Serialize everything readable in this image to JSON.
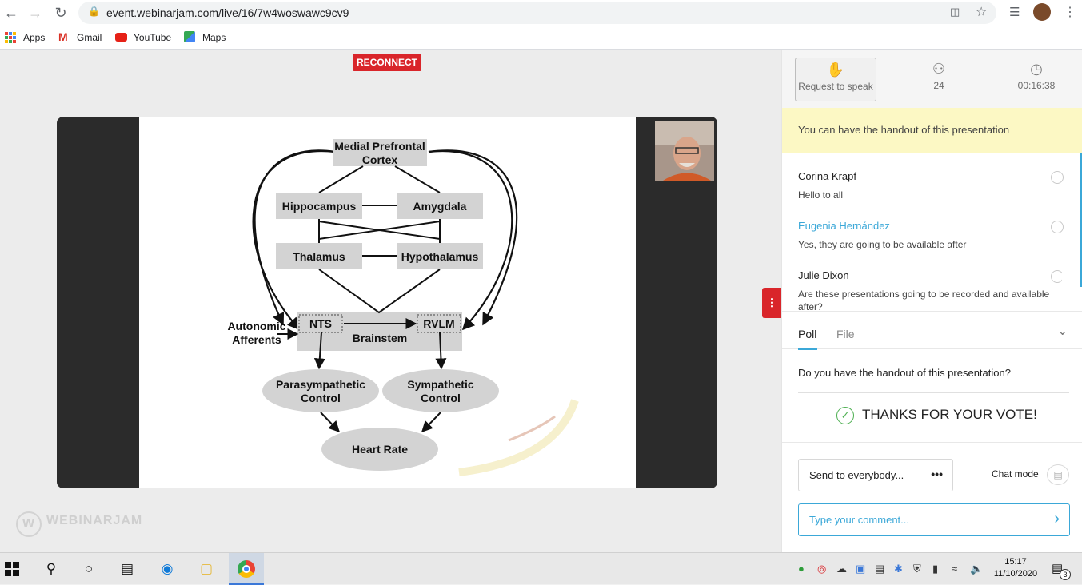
{
  "browser": {
    "url": "event.webinarjam.com/live/16/7w4woswawc9cv9",
    "bookmarks": [
      "Apps",
      "Gmail",
      "YouTube",
      "Maps"
    ]
  },
  "stage": {
    "reconnect_label": "RECONNECT",
    "watermark": "WEBINARJAM"
  },
  "slide": {
    "nodes": {
      "mpfc": [
        "Medial Prefrontal",
        "Cortex"
      ],
      "hippocampus": "Hippocampus",
      "amygdala": "Amygdala",
      "thalamus": "Thalamus",
      "hypothalamus": "Hypothalamus",
      "nts": "NTS",
      "rvlm": "RVLM",
      "brainstem": "Brainstem",
      "afferents": [
        "Autonomic",
        "Afferents"
      ],
      "parasympathetic": [
        "Parasympathetic",
        "Control"
      ],
      "sympathetic": [
        "Sympathetic",
        "Control"
      ],
      "heart_rate": "Heart Rate"
    }
  },
  "panel": {
    "request_label": "Request to speak",
    "attendees": "24",
    "elapsed": "00:16:38",
    "banner": "You can have the handout of this presentation",
    "messages": [
      {
        "name": "Corina Krapf",
        "text": "Hello to all"
      },
      {
        "name": "Eugenia Hernández",
        "text": "Yes, they are going to be available after"
      },
      {
        "name": "Julie Dixon",
        "text": "Are these presentations going to be recorded and available after?"
      }
    ],
    "tabs": [
      "Poll",
      "File"
    ],
    "poll_question": "Do you have the handout of this presentation?",
    "poll_result": "THANKS FOR YOUR VOTE!",
    "send_to": "Send to everybody...",
    "chat_mode": "Chat mode",
    "comment_placeholder": "Type your comment..."
  },
  "taskbar": {
    "time": "15:17",
    "date": "11/10/2020",
    "notifications": "3"
  },
  "colors": {
    "accent": "#3ba8d8",
    "reconnect": "#d9252a",
    "banner": "#fcf8c4",
    "success": "#4caf50"
  }
}
